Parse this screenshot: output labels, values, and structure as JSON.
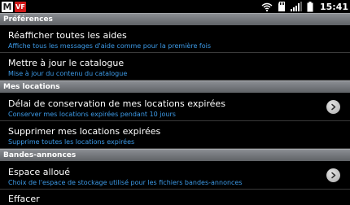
{
  "status_bar": {
    "left_icons": [
      "m-notification-icon",
      "vf-notification-icon"
    ],
    "m_label": "M",
    "vf_label": "VF",
    "right_icons": [
      "wifi-icon",
      "sd-card-icon",
      "signal-icon",
      "battery-icon"
    ],
    "time": "15:41"
  },
  "sections": [
    {
      "header": "Préférences",
      "items": [
        {
          "title": "Réafficher toutes les aides",
          "subtitle": "Affiche tous les messages d'aide comme pour la première fois",
          "chevron": false
        },
        {
          "title": "Mettre à jour le catalogue",
          "subtitle": "Mise à jour du contenu du catalogue",
          "chevron": false
        }
      ]
    },
    {
      "header": "Mes locations",
      "items": [
        {
          "title": "Délai de conservation de mes locations expirées",
          "subtitle": "Conserver mes locations expirées pendant 10 jours",
          "chevron": true
        },
        {
          "title": "Supprimer mes locations expirées",
          "subtitle": "Supprime toutes les locations expirées",
          "chevron": false
        }
      ]
    },
    {
      "header": "Bandes-annonces",
      "items": [
        {
          "title": "Espace alloué",
          "subtitle": "Choix de l'espace de stockage utilisé pour les fichiers bandes-annonces",
          "chevron": true
        },
        {
          "title": "Effacer",
          "subtitle": "",
          "chevron": false
        }
      ]
    }
  ],
  "colors": {
    "background": "#000000",
    "section_header": "#6f7276",
    "subtitle": "#3d9be8",
    "title": "#ffffff"
  }
}
